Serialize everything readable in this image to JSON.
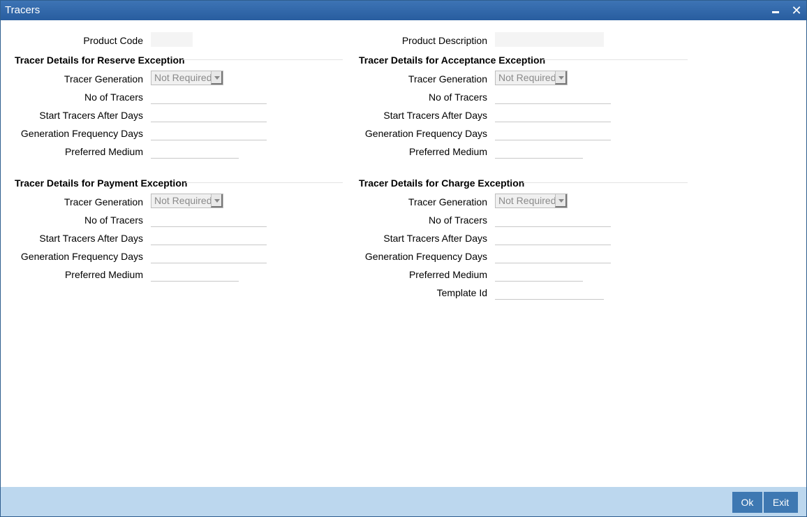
{
  "window": {
    "title": "Tracers",
    "minimize_icon": "minimize-icon",
    "close_icon": "close-icon",
    "close_glyph": "✕"
  },
  "header": {
    "product_code_label": "Product Code",
    "product_code_value": "",
    "product_description_label": "Product Description",
    "product_description_value": ""
  },
  "sections": {
    "reserve": {
      "title": "Tracer Details for Reserve Exception",
      "tracer_generation_label": "Tracer Generation",
      "tracer_generation_value": "Not Required",
      "no_of_tracers_label": "No of Tracers",
      "start_after_days_label": "Start Tracers After Days",
      "frequency_days_label": "Generation Frequency Days",
      "preferred_medium_label": "Preferred Medium"
    },
    "acceptance": {
      "title": "Tracer Details for Acceptance Exception",
      "tracer_generation_label": "Tracer Generation",
      "tracer_generation_value": "Not Required",
      "no_of_tracers_label": "No of Tracers",
      "start_after_days_label": "Start Tracers After Days",
      "frequency_days_label": "Generation Frequency Days",
      "preferred_medium_label": "Preferred Medium"
    },
    "payment": {
      "title": "Tracer Details for Payment Exception",
      "tracer_generation_label": "Tracer Generation",
      "tracer_generation_value": "Not Required",
      "no_of_tracers_label": "No of Tracers",
      "start_after_days_label": "Start Tracers After Days",
      "frequency_days_label": "Generation Frequency Days",
      "preferred_medium_label": "Preferred Medium"
    },
    "charge": {
      "title": "Tracer Details for Charge Exception",
      "tracer_generation_label": "Tracer Generation",
      "tracer_generation_value": "Not Required",
      "no_of_tracers_label": "No of Tracers",
      "start_after_days_label": "Start Tracers After Days",
      "frequency_days_label": "Generation Frequency Days",
      "preferred_medium_label": "Preferred Medium",
      "template_id_label": "Template Id"
    }
  },
  "footer": {
    "ok_label": "Ok",
    "exit_label": "Exit"
  }
}
